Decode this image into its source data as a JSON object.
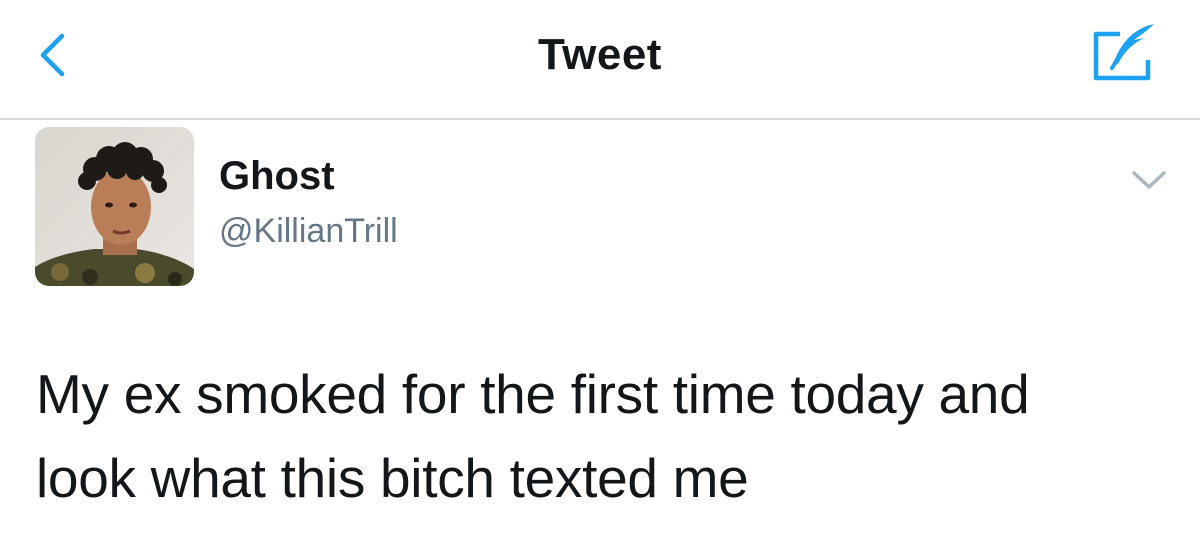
{
  "nav": {
    "title": "Tweet",
    "back_icon": "chevron-left-icon",
    "compose_icon": "compose-tweet-icon",
    "accent_color": "#1da1f2"
  },
  "tweet": {
    "author": {
      "display_name": "Ghost",
      "username": "@KillianTrill",
      "avatar_icon": "profile-photo"
    },
    "menu_icon": "chevron-down-icon",
    "text_lines": [
      "My ex smoked for the first time today and",
      "look what this bitch texted me"
    ]
  }
}
